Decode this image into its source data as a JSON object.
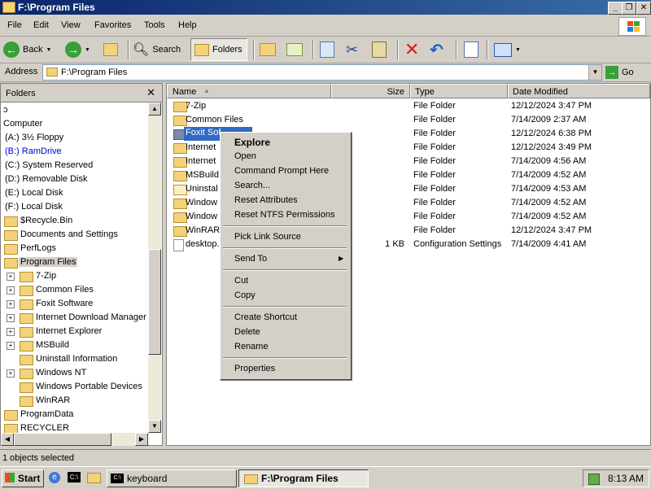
{
  "window": {
    "title": "F:\\Program Files"
  },
  "menu": [
    "File",
    "Edit",
    "View",
    "Favorites",
    "Tools",
    "Help"
  ],
  "toolbar": {
    "back": "Back",
    "search": "Search",
    "folders": "Folders"
  },
  "address": {
    "label": "Address",
    "value": "F:\\Program Files",
    "go": "Go"
  },
  "folders_pane": {
    "title": "Folders",
    "close": "✕",
    "items": [
      {
        "label": "ɔ"
      },
      {
        "label": "Computer"
      },
      {
        "label": "(A:) 3½ Floppy"
      },
      {
        "label": "(B:) RamDrive"
      },
      {
        "label": "(C:) System Reserved"
      },
      {
        "label": "(D:) Removable Disk"
      },
      {
        "label": "(E:) Local Disk"
      },
      {
        "label": "(F:) Local Disk"
      },
      {
        "label": "$Recycle.Bin"
      },
      {
        "label": "Documents and Settings"
      },
      {
        "label": "PerfLogs"
      },
      {
        "label": "Program Files"
      },
      {
        "label": "7-Zip"
      },
      {
        "label": "Common Files"
      },
      {
        "label": "Foxit Software"
      },
      {
        "label": "Internet Download Manager"
      },
      {
        "label": "Internet Explorer"
      },
      {
        "label": "MSBuild"
      },
      {
        "label": "Uninstall Information"
      },
      {
        "label": "Windows NT"
      },
      {
        "label": "Windows Portable Devices"
      },
      {
        "label": "WinRAR"
      },
      {
        "label": "ProgramData"
      },
      {
        "label": "RECYCLER"
      }
    ]
  },
  "columns": {
    "name": "Name",
    "size": "Size",
    "type": "Type",
    "modified": "Date Modified"
  },
  "files": [
    {
      "name": "7-Zip",
      "size": "",
      "type": "File Folder",
      "date": "12/12/2024 3:47 PM"
    },
    {
      "name": "Common Files",
      "size": "",
      "type": "File Folder",
      "date": "7/14/2009 2:37 AM"
    },
    {
      "name": "Foxit Sof",
      "size": "",
      "type": "File Folder",
      "date": "12/12/2024 6:38 PM"
    },
    {
      "name": "Internet",
      "size": "",
      "type": "File Folder",
      "date": "12/12/2024 3:49 PM"
    },
    {
      "name": "Internet",
      "size": "",
      "type": "File Folder",
      "date": "7/14/2009 4:56 AM"
    },
    {
      "name": "MSBuild",
      "size": "",
      "type": "File Folder",
      "date": "7/14/2009 4:52 AM"
    },
    {
      "name": "Uninstal",
      "size": "",
      "type": "File Folder",
      "date": "7/14/2009 4:53 AM"
    },
    {
      "name": "Window",
      "size": "",
      "type": "File Folder",
      "date": "7/14/2009 4:52 AM"
    },
    {
      "name": "Window",
      "size": "",
      "type": "File Folder",
      "date": "7/14/2009 4:52 AM"
    },
    {
      "name": "WinRAR",
      "size": "",
      "type": "File Folder",
      "date": "12/12/2024 3:47 PM"
    },
    {
      "name": "desktop.",
      "size": "1 KB",
      "type": "Configuration Settings",
      "date": "7/14/2009 4:41 AM"
    }
  ],
  "context_menu": {
    "explore": "Explore",
    "open": "Open",
    "cmd": "Command Prompt Here",
    "search": "Search...",
    "reset_attr": "Reset Attributes",
    "reset_ntfs": "Reset NTFS Permissions",
    "pick_link": "Pick Link Source",
    "send_to": "Send To",
    "cut": "Cut",
    "copy": "Copy",
    "create_shortcut": "Create Shortcut",
    "delete": "Delete",
    "rename": "Rename",
    "properties": "Properties"
  },
  "status": {
    "text": "1 objects selected"
  },
  "taskbar": {
    "start": "Start",
    "task_keyboard": "keyboard",
    "task_explorer": "F:\\Program Files",
    "clock": "8:13 AM"
  }
}
